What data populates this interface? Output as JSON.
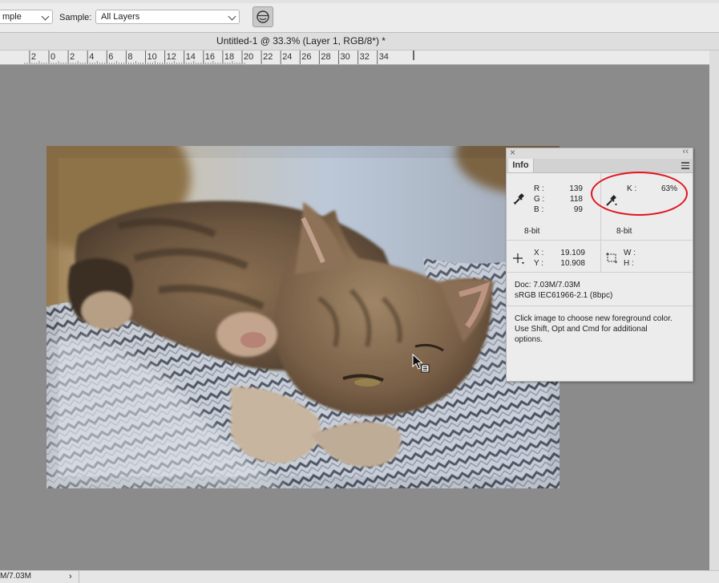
{
  "options_bar": {
    "sample_size_value": "mple",
    "sample_label": "Sample:",
    "sample_value": "All Layers",
    "sample_ring_toggle": "show-sampling-ring-icon"
  },
  "document_tab": {
    "title": "Untitled-1 @ 33.3% (Layer 1, RGB/8*) *"
  },
  "ruler": {
    "labels": [
      "2",
      "0",
      "2",
      "4",
      "6",
      "8",
      "10",
      "12",
      "14",
      "16",
      "18",
      "20",
      "22",
      "24",
      "26",
      "28",
      "30",
      "32",
      "34"
    ]
  },
  "status_bar": {
    "doc_size": "M/7.03M",
    "arrow": "›"
  },
  "info_panel": {
    "tab_label": "Info",
    "close_icon": "×",
    "collapse_icon": "‹‹",
    "rgb": {
      "r_label": "R :",
      "r_value": "139",
      "g_label": "G :",
      "g_value": "118",
      "b_label": "B :",
      "b_value": "99",
      "bit_depth": "8-bit"
    },
    "k": {
      "k_label": "K :",
      "k_value": "63%",
      "bit_depth": "8-bit"
    },
    "xy": {
      "x_label": "X :",
      "x_value": "19.109",
      "y_label": "Y :",
      "y_value": "10.908"
    },
    "wh": {
      "w_label": "W :",
      "h_label": "H :"
    },
    "doc_info": "Doc: 7.03M/7.03M",
    "color_profile": "sRGB IEC61966-2.1 (8bpc)",
    "hint": "Click image to choose new foreground color.  Use Shift, Opt and Cmd for additional options."
  },
  "colors": {
    "annotation_circle": "#e0141e",
    "pasteboard": "#8b8b8b",
    "panel_bg": "#ececec"
  }
}
